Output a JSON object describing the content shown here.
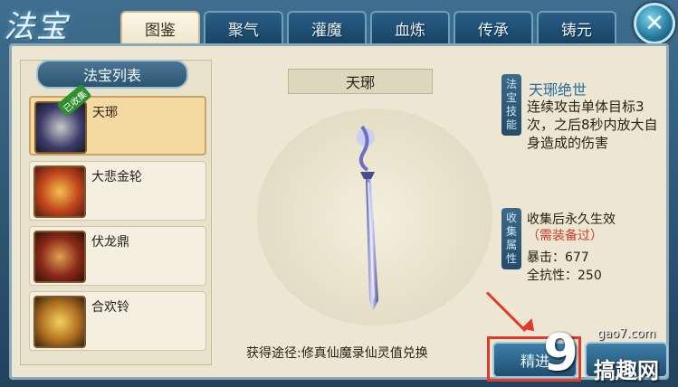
{
  "header": {
    "logo_text": "法宝",
    "tabs": [
      {
        "label": "图鉴",
        "active": true
      },
      {
        "label": "聚气",
        "active": false
      },
      {
        "label": "灌魔",
        "active": false
      },
      {
        "label": "血炼",
        "active": false
      },
      {
        "label": "传承",
        "active": false
      },
      {
        "label": "铸元",
        "active": false
      }
    ],
    "close_icon": "close-icon"
  },
  "list": {
    "title": "法宝列表",
    "items": [
      {
        "label": "天琊",
        "badge": "已收集",
        "selected": true
      },
      {
        "label": "大悲金轮",
        "selected": false
      },
      {
        "label": "伏龙鼎",
        "selected": false
      },
      {
        "label": "合欢铃",
        "selected": false
      }
    ]
  },
  "center": {
    "name": "天琊",
    "obtain_text": "获得途径:修真仙魔录仙灵值兑换"
  },
  "right": {
    "skill_tag": "法宝技能",
    "skill_name": "天琊绝世",
    "skill_desc": "连续攻击单体目标3次，之后8秒内放大自身造成的伤害",
    "collect_tag": "收集属性",
    "collect_note": "收集后永久生效",
    "collect_req": "（需装备过）",
    "stats": [
      {
        "name": "暴击",
        "value": "677"
      },
      {
        "name": "全抗性",
        "value": "250"
      }
    ],
    "refine_button": "精进"
  },
  "watermark": {
    "domain": "gao7.com",
    "text": "搞趣网"
  },
  "colors": {
    "accent_red": "#e23a2a",
    "skill_blue": "#2a6c9a",
    "parchment": "#ece6d2"
  }
}
